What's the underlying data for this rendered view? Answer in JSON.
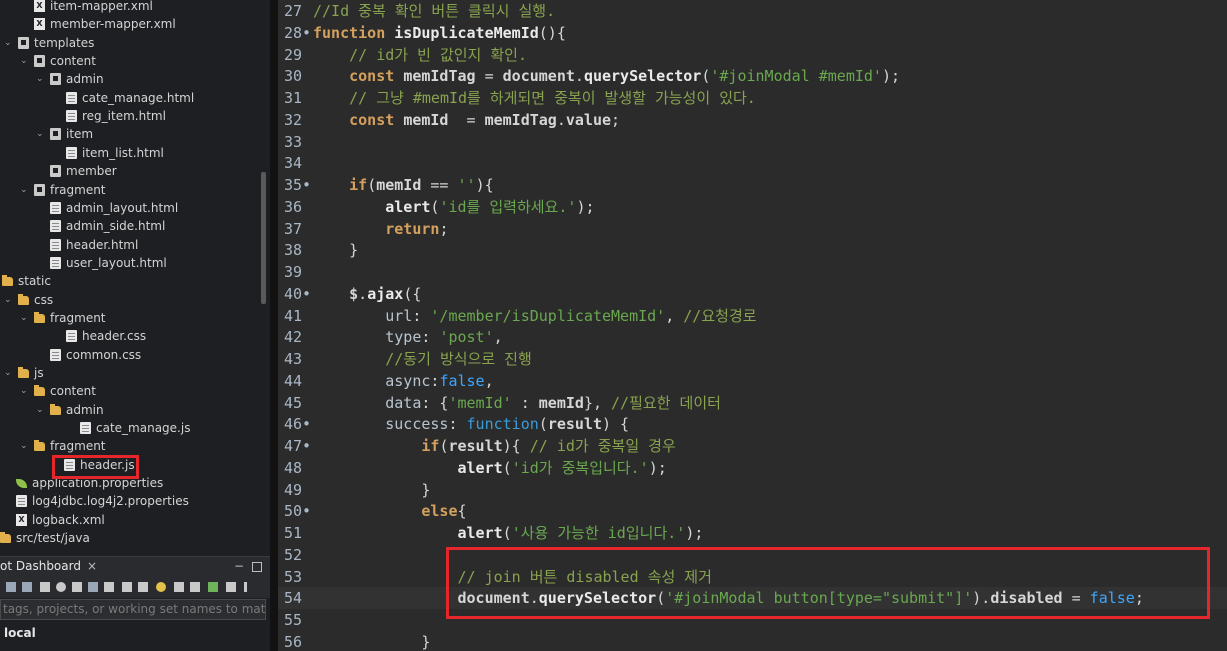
{
  "tree": {
    "items": [
      {
        "label": "item-mapper.xml",
        "icon": "xml-file-icon"
      },
      {
        "label": "member-mapper.xml",
        "icon": "xml-file-icon"
      },
      {
        "label": "templates",
        "icon": "package-icon"
      },
      {
        "label": "content",
        "icon": "package-icon"
      },
      {
        "label": "admin",
        "icon": "package-icon"
      },
      {
        "label": "cate_manage.html",
        "icon": "html-file-icon"
      },
      {
        "label": "reg_item.html",
        "icon": "html-file-icon"
      },
      {
        "label": "item",
        "icon": "package-icon"
      },
      {
        "label": "item_list.html",
        "icon": "html-file-icon"
      },
      {
        "label": "member",
        "icon": "package-icon"
      },
      {
        "label": "fragment",
        "icon": "package-icon"
      },
      {
        "label": "admin_layout.html",
        "icon": "html-file-icon"
      },
      {
        "label": "admin_side.html",
        "icon": "html-file-icon"
      },
      {
        "label": "header.html",
        "icon": "html-file-icon"
      },
      {
        "label": "user_layout.html",
        "icon": "html-file-icon"
      },
      {
        "label": "static",
        "icon": "folder-icon"
      },
      {
        "label": "css",
        "icon": "folder-icon"
      },
      {
        "label": "fragment",
        "icon": "folder-icon"
      },
      {
        "label": "header.css",
        "icon": "css-file-icon"
      },
      {
        "label": "common.css",
        "icon": "css-file-icon"
      },
      {
        "label": "js",
        "icon": "folder-icon"
      },
      {
        "label": "content",
        "icon": "folder-icon"
      },
      {
        "label": "admin",
        "icon": "folder-icon"
      },
      {
        "label": "cate_manage.js",
        "icon": "js-file-icon"
      },
      {
        "label": "fragment",
        "icon": "folder-icon"
      },
      {
        "label": "header.js",
        "icon": "js-file-icon"
      },
      {
        "label": "application.properties",
        "icon": "spring-leaf-icon"
      },
      {
        "label": "log4jdbc.log4j2.properties",
        "icon": "properties-file-icon"
      },
      {
        "label": "logback.xml",
        "icon": "xml-file-icon"
      },
      {
        "label": "src/test/java",
        "icon": "source-folder-icon"
      }
    ]
  },
  "dashboard": {
    "tab_label": "ot Dashboard",
    "close_glyph": "×",
    "minimize_glyph": "−",
    "filter_placeholder": "tags, projects, or working set names to match (in",
    "local_label": "local"
  },
  "editor": {
    "lines": [
      {
        "n": "27",
        "fold": false,
        "text": "//Id 중복 확인 버튼 클릭시 실행."
      },
      {
        "n": "28",
        "fold": true,
        "text": "function isDuplicateMemId(){"
      },
      {
        "n": "29",
        "fold": false,
        "text": "    // id가 빈 값인지 확인."
      },
      {
        "n": "30",
        "fold": false,
        "text": "    const memIdTag = document.querySelector('#joinModal #memId');"
      },
      {
        "n": "31",
        "fold": false,
        "text": "    // 그냥 #memId를 하게되면 중복이 발생할 가능성이 있다."
      },
      {
        "n": "32",
        "fold": false,
        "text": "    const memId  = memIdTag.value;"
      },
      {
        "n": "33",
        "fold": false,
        "text": ""
      },
      {
        "n": "34",
        "fold": false,
        "text": ""
      },
      {
        "n": "35",
        "fold": true,
        "text": "    if(memId == ''){"
      },
      {
        "n": "36",
        "fold": false,
        "text": "        alert('id를 입력하세요.');"
      },
      {
        "n": "37",
        "fold": false,
        "text": "        return;"
      },
      {
        "n": "38",
        "fold": false,
        "text": "    }"
      },
      {
        "n": "39",
        "fold": false,
        "text": ""
      },
      {
        "n": "40",
        "fold": true,
        "text": "    $.ajax({"
      },
      {
        "n": "41",
        "fold": false,
        "text": "        url: '/member/isDuplicateMemId', //요청경로"
      },
      {
        "n": "42",
        "fold": false,
        "text": "        type: 'post',"
      },
      {
        "n": "43",
        "fold": false,
        "text": "        //동기 방식으로 진행"
      },
      {
        "n": "44",
        "fold": false,
        "text": "        async:false,"
      },
      {
        "n": "45",
        "fold": false,
        "text": "        data: {'memId' : memId}, //필요한 데이터"
      },
      {
        "n": "46",
        "fold": true,
        "text": "        success: function(result) {"
      },
      {
        "n": "47",
        "fold": true,
        "text": "            if(result){ // id가 중복일 경우"
      },
      {
        "n": "48",
        "fold": false,
        "text": "                alert('id가 중복입니다.');"
      },
      {
        "n": "49",
        "fold": false,
        "text": "            }"
      },
      {
        "n": "50",
        "fold": true,
        "text": "            else{"
      },
      {
        "n": "51",
        "fold": false,
        "text": "                alert('사용 가능한 id입니다.');"
      },
      {
        "n": "52",
        "fold": false,
        "text": ""
      },
      {
        "n": "53",
        "fold": false,
        "text": "                // join 버튼 disabled 속성 제거"
      },
      {
        "n": "54",
        "fold": false,
        "text": "                document.querySelector('#joinModal button[type=\"submit\"]').disabled = false;"
      },
      {
        "n": "55",
        "fold": false,
        "text": ""
      },
      {
        "n": "56",
        "fold": false,
        "text": "            }"
      }
    ]
  },
  "colors": {
    "highlight_box": "#e5262a",
    "editor_bg": "#2b2b2b",
    "sidebar_bg": "#1e1f22"
  }
}
